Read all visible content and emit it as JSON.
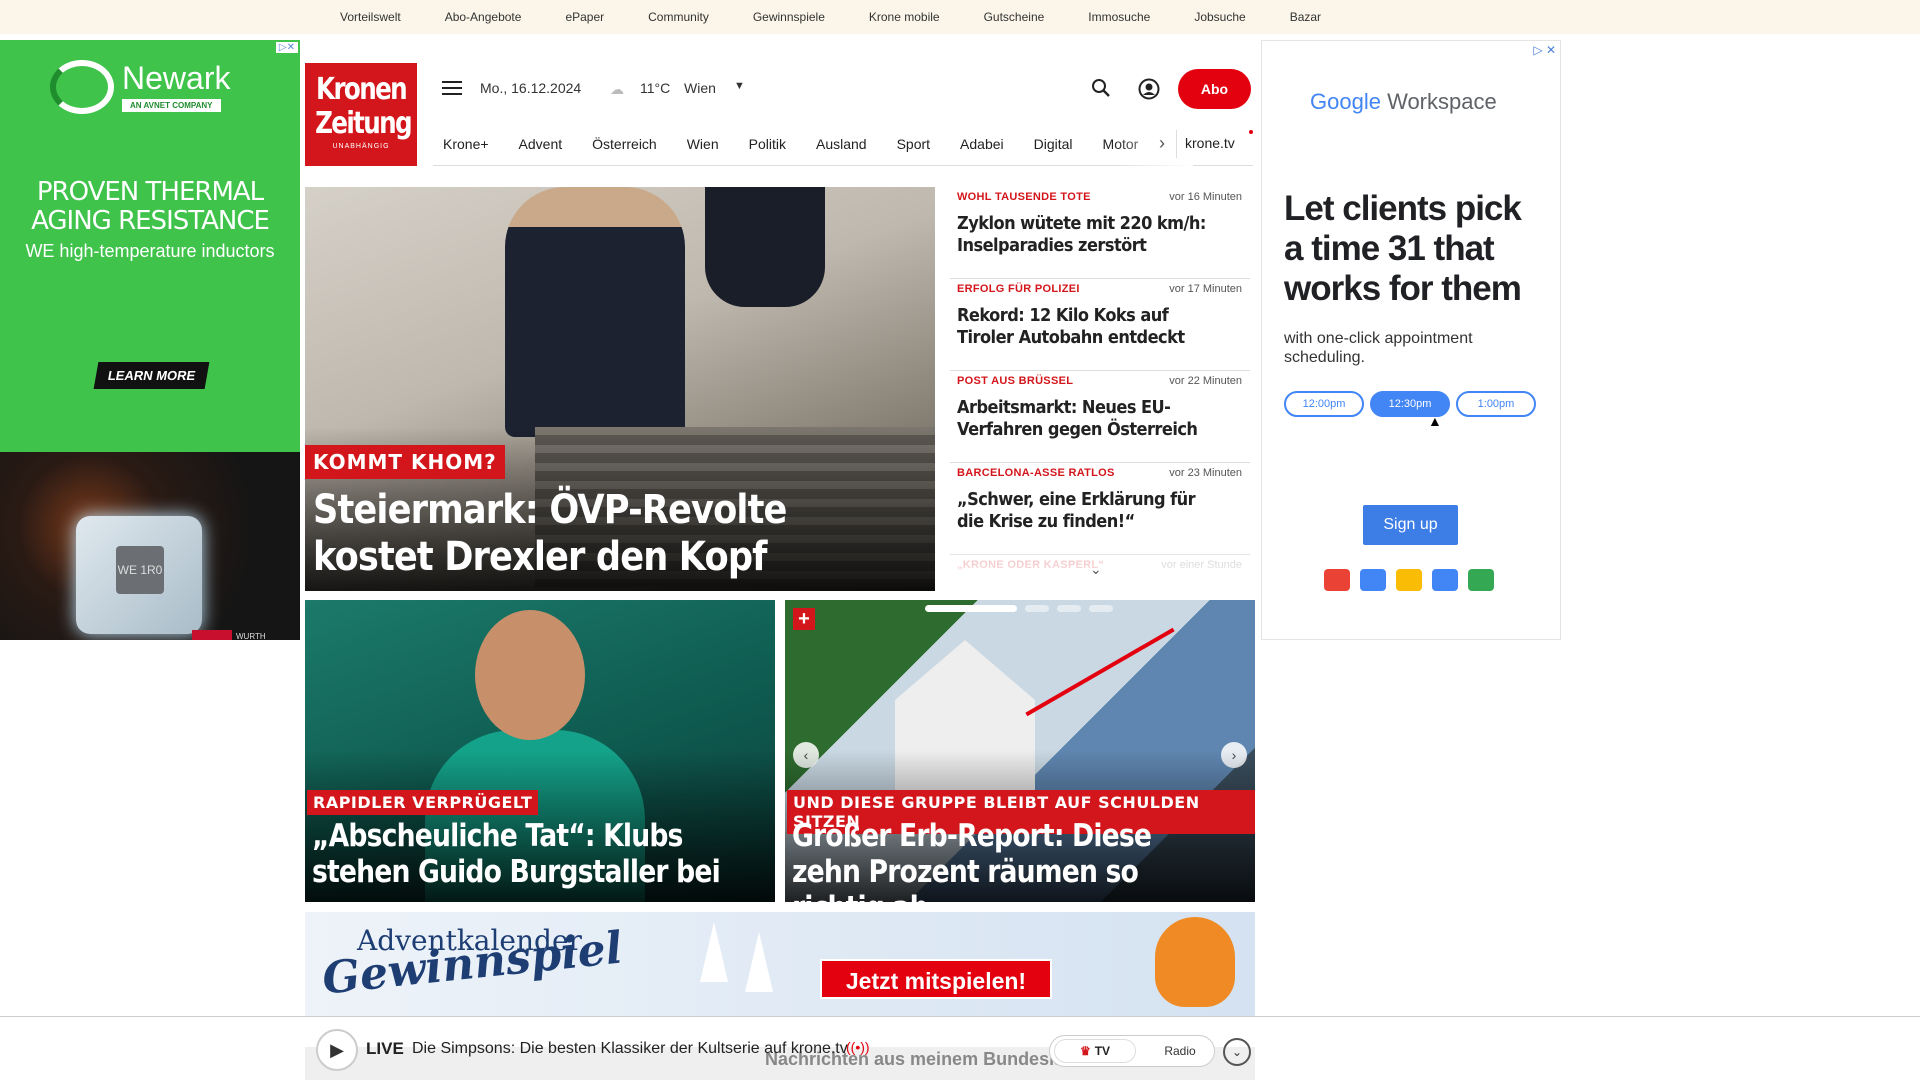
{
  "topbar": {
    "links": [
      "Vorteilswelt",
      "Abo-Angebote",
      "ePaper",
      "Community",
      "Gewinnspiele",
      "Krone mobile",
      "Gutscheine",
      "Immosuche",
      "Jobsuche",
      "Bazar"
    ]
  },
  "ad_left": {
    "adchoice": "▷✕",
    "brand": "Newark",
    "brand_sub": "AN AVNET COMPANY",
    "headline": "PROVEN THERMAL AGING RESISTANCE",
    "subline": "WE high-temperature inductors",
    "cta": "LEARN MORE",
    "cube_label": "WE 1R0",
    "badge": "WE",
    "wurth": "WURTH ELEKTRONIK MORE THAN YOU EXPECT"
  },
  "header": {
    "logo_line1": "Kronen",
    "logo_line2": "Zeitung",
    "logo_tagline": "UNABHÄNGIG",
    "date": "Mo., 16.12.2024",
    "weather_icon": "cloud-icon",
    "temperature": "11°C",
    "city": "Wien",
    "abo_label": "Abo"
  },
  "nav": {
    "items": [
      "Krone+",
      "Advent",
      "Österreich",
      "Wien",
      "Politik",
      "Ausland",
      "Sport",
      "Adabei",
      "Digital",
      "Motor"
    ],
    "tv_link": "krone.tv"
  },
  "hero": {
    "kicker": "KOMMT KHOM?",
    "title": "Steiermark: ÖVP-Revolte kostet Drexler den Kopf"
  },
  "ticker": {
    "entries": [
      {
        "kicker": "WOHL TAUSENDE TOTE",
        "time": "vor 16 Minuten",
        "headline": "Zyklon wütete mit 220 km/h: Inselparadies zerstört"
      },
      {
        "kicker": "ERFOLG FÜR POLIZEI",
        "time": "vor 17 Minuten",
        "headline": "Rekord: 12 Kilo Koks auf Tiroler Autobahn entdeckt"
      },
      {
        "kicker": "POST AUS BRÜSSEL",
        "time": "vor 22 Minuten",
        "headline": "Arbeitsmarkt: Neues EU-Verfahren gegen Österreich"
      },
      {
        "kicker": "BARCELONA-ASSE RATLOS",
        "time": "vor 23 Minuten",
        "headline": "„Schwer, eine Erklärung für die Krise zu finden!“"
      },
      {
        "kicker": "„KRONE ODER KASPERL“",
        "time": "vor einer Stunde",
        "headline": ""
      }
    ]
  },
  "cards": [
    {
      "kicker": "RAPIDLER VERPRÜGELT",
      "title": "„Abscheuliche Tat“: Klubs stehen Guido Burgstaller bei"
    },
    {
      "kicker": "UND DIESE GRUPPE BLEIBT AUF SCHULDEN SITZEN",
      "title": "Großer Erb-Report: Diese zehn Prozent räumen so richtig ab",
      "badge": "+"
    }
  ],
  "advent": {
    "line1": "Adventkalender",
    "line2": "Gewinnspiel",
    "cta": "Jetzt mitspielen!"
  },
  "livebar": {
    "behind_text": "Nachrichten aus meinem Bundesland",
    "live_label": "LIVE",
    "text": "Die Simpsons: Die besten Klassiker der Kultserie auf krone.tv",
    "tv_label": "TV",
    "radio_label": "Radio"
  },
  "ad_right": {
    "brand_google": "Google",
    "brand_workspace": "Workspace",
    "headline": "Let clients pick a time 31 that works for them",
    "subline": "with one-click appointment scheduling.",
    "slots": [
      "12:00pm",
      "12:30pm",
      "1:00pm"
    ],
    "selected_slot": "12:30pm",
    "signup": "Sign up",
    "app_colors": [
      "#ea4335",
      "#4285f4",
      "#fbbc05",
      "#4285f4",
      "#34a853"
    ]
  }
}
